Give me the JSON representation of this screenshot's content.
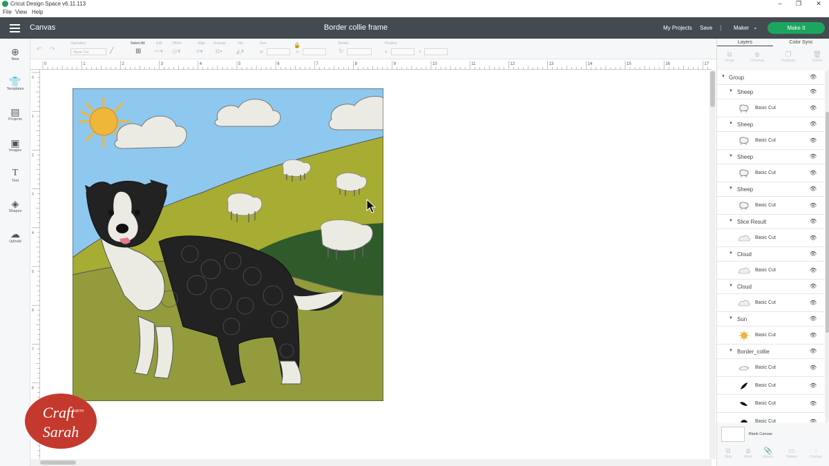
{
  "window": {
    "title": "Cricut Design Space  v6.11.113",
    "min": "–",
    "max": "❐",
    "close": "✕"
  },
  "menu": [
    "File",
    "View",
    "Help"
  ],
  "header": {
    "section": "Canvas",
    "project_title": "Border collie frame",
    "my_projects": "My Projects",
    "save": "Save",
    "separator": "|",
    "machine": "Maker",
    "make_it": "Make It"
  },
  "toolbar": {
    "operation_label": "Operation",
    "operation_value": "Basic Cut",
    "select_all": "Select All",
    "edit": "Edit",
    "offset": "Offset",
    "align": "Align",
    "arrange": "Arrange",
    "flip": "Flip",
    "size": "Size",
    "size_w": "W",
    "size_h": "H",
    "rotate": "Rotate",
    "position": "Position",
    "pos_x": "X",
    "pos_y": "Y"
  },
  "sidebar": [
    {
      "label": "New",
      "icon": "plus-circle-icon"
    },
    {
      "label": "Templates",
      "icon": "tshirt-icon"
    },
    {
      "label": "Projects",
      "icon": "projects-icon"
    },
    {
      "label": "Images",
      "icon": "images-icon"
    },
    {
      "label": "Text",
      "icon": "text-icon"
    },
    {
      "label": "Shapes",
      "icon": "shapes-icon"
    },
    {
      "label": "Upload",
      "icon": "upload-icon"
    }
  ],
  "ruler": {
    "top": [
      "0",
      "1",
      "2",
      "3",
      "4",
      "5",
      "6",
      "7",
      "8",
      "9",
      "10",
      "11",
      "12",
      "13",
      "14",
      "15",
      "16",
      "17"
    ],
    "left": [
      "0",
      "1",
      "2",
      "3",
      "4",
      "5",
      "6",
      "7",
      "8",
      "9"
    ]
  },
  "panel": {
    "tabs": [
      "Layers",
      "Color Sync"
    ],
    "actions": [
      "Group",
      "UnGroup",
      "Duplicate",
      "Delete"
    ],
    "layers": [
      {
        "kind": "head",
        "name": "Group",
        "indent": 0
      },
      {
        "kind": "head",
        "name": "Sheep",
        "indent": 1
      },
      {
        "kind": "sub",
        "label": "Basic Cut",
        "thumb": "sheep"
      },
      {
        "kind": "head",
        "name": "Sheep",
        "indent": 1
      },
      {
        "kind": "sub",
        "label": "Basic Cut",
        "thumb": "sheep"
      },
      {
        "kind": "head",
        "name": "Sheep",
        "indent": 1
      },
      {
        "kind": "sub",
        "label": "Basic Cut",
        "thumb": "sheep"
      },
      {
        "kind": "head",
        "name": "Sheep",
        "indent": 1
      },
      {
        "kind": "sub",
        "label": "Basic Cut",
        "thumb": "sheep"
      },
      {
        "kind": "head",
        "name": "Slice Result",
        "indent": 1
      },
      {
        "kind": "sub",
        "label": "Basic Cut",
        "thumb": "cloud"
      },
      {
        "kind": "head",
        "name": "Cloud",
        "indent": 1
      },
      {
        "kind": "sub",
        "label": "Basic Cut",
        "thumb": "cloud"
      },
      {
        "kind": "head",
        "name": "Cloud",
        "indent": 1
      },
      {
        "kind": "sub",
        "label": "Basic Cut",
        "thumb": "cloud"
      },
      {
        "kind": "head",
        "name": "Sun",
        "indent": 1
      },
      {
        "kind": "sub",
        "label": "Basic Cut",
        "thumb": "sun"
      },
      {
        "kind": "head",
        "name": "Border_collie",
        "indent": 1
      },
      {
        "kind": "sub",
        "label": "Basic Cut",
        "thumb": "white"
      },
      {
        "kind": "sub",
        "label": "Basic Cut",
        "thumb": "black1"
      },
      {
        "kind": "sub",
        "label": "Basic Cut",
        "thumb": "black2"
      },
      {
        "kind": "sub",
        "label": "Basic Cut",
        "thumb": "black3"
      }
    ],
    "blank_canvas": "Blank Canvas",
    "bottom_actions": [
      "Slice",
      "Weld",
      "Attach",
      "Flatten",
      "Contour"
    ]
  },
  "logo": {
    "line1": "Craft",
    "with": "WITH",
    "line2": "Sarah"
  },
  "colors": {
    "header": "#434a50",
    "make_it": "#1ca55e",
    "sky": "#8ec8ef",
    "hill_light": "#a7ac33",
    "hill_dark": "#2f5b2a",
    "ground": "#949b3d",
    "sun": "#f0b63a",
    "cloud": "#ecebe3",
    "logo": "#c4392d"
  }
}
